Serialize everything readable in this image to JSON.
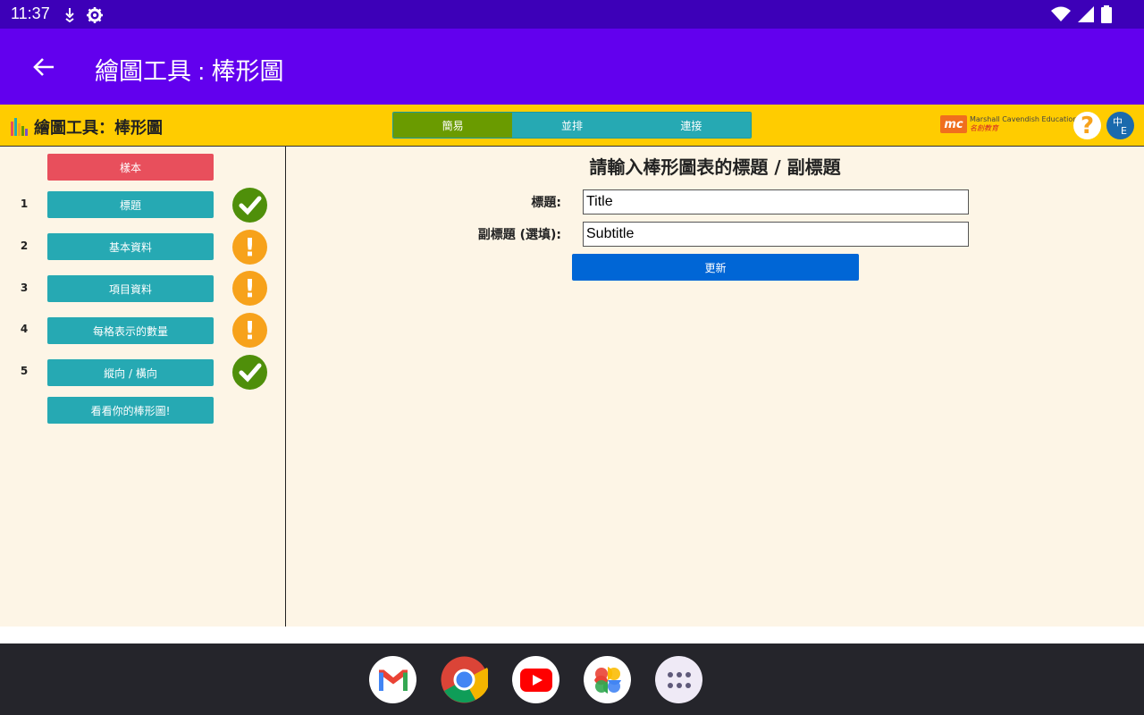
{
  "status_bar": {
    "time": "11:37"
  },
  "app_bar": {
    "title": "繪圖工具 : 棒形圖"
  },
  "header": {
    "logo_title": "繪圖工具：棒形圖",
    "tabs": [
      {
        "label": "簡易",
        "active": true
      },
      {
        "label": "並排",
        "active": false
      },
      {
        "label": "連接",
        "active": false
      }
    ],
    "brand": {
      "mark": "mc",
      "name_en": "Marshall Cavendish Education",
      "name_cn": "名創教育"
    },
    "help_label": "?",
    "lang_zh": "中",
    "lang_en": "E"
  },
  "sidebar": {
    "sample_label": "樣本",
    "steps": [
      {
        "num": "1",
        "label": "標題",
        "status": "complete"
      },
      {
        "num": "2",
        "label": "基本資料",
        "status": "incomplete"
      },
      {
        "num": "3",
        "label": "項目資料",
        "status": "incomplete"
      },
      {
        "num": "4",
        "label": "每格表示的數量",
        "status": "incomplete"
      },
      {
        "num": "5",
        "label": "縱向 / 橫向",
        "status": "complete"
      }
    ],
    "view_label": "看看你的棒形圖!",
    "warn_glyph": "!"
  },
  "main": {
    "heading": "請輸入棒形圖表的標題 / 副標題",
    "title_label": "標題:",
    "title_value": "Title",
    "subtitle_label": "副標題 (選填):",
    "subtitle_value": "Subtitle",
    "update_label": "更新"
  },
  "dock": {
    "apps": [
      "gmail-icon",
      "chrome-icon",
      "youtube-icon",
      "photos-icon",
      "app-drawer-icon"
    ]
  },
  "colors": {
    "status_bar": "#3d00b8",
    "app_bar": "#6200ee",
    "header": "#ffcc00",
    "teal": "#26a9b3",
    "active_tab": "#6a9b00",
    "sample": "#e84f5c",
    "ok": "#4f8f0a",
    "warn": "#f7a21b",
    "update": "#0066d6",
    "panel_bg": "#fdf5e6"
  }
}
